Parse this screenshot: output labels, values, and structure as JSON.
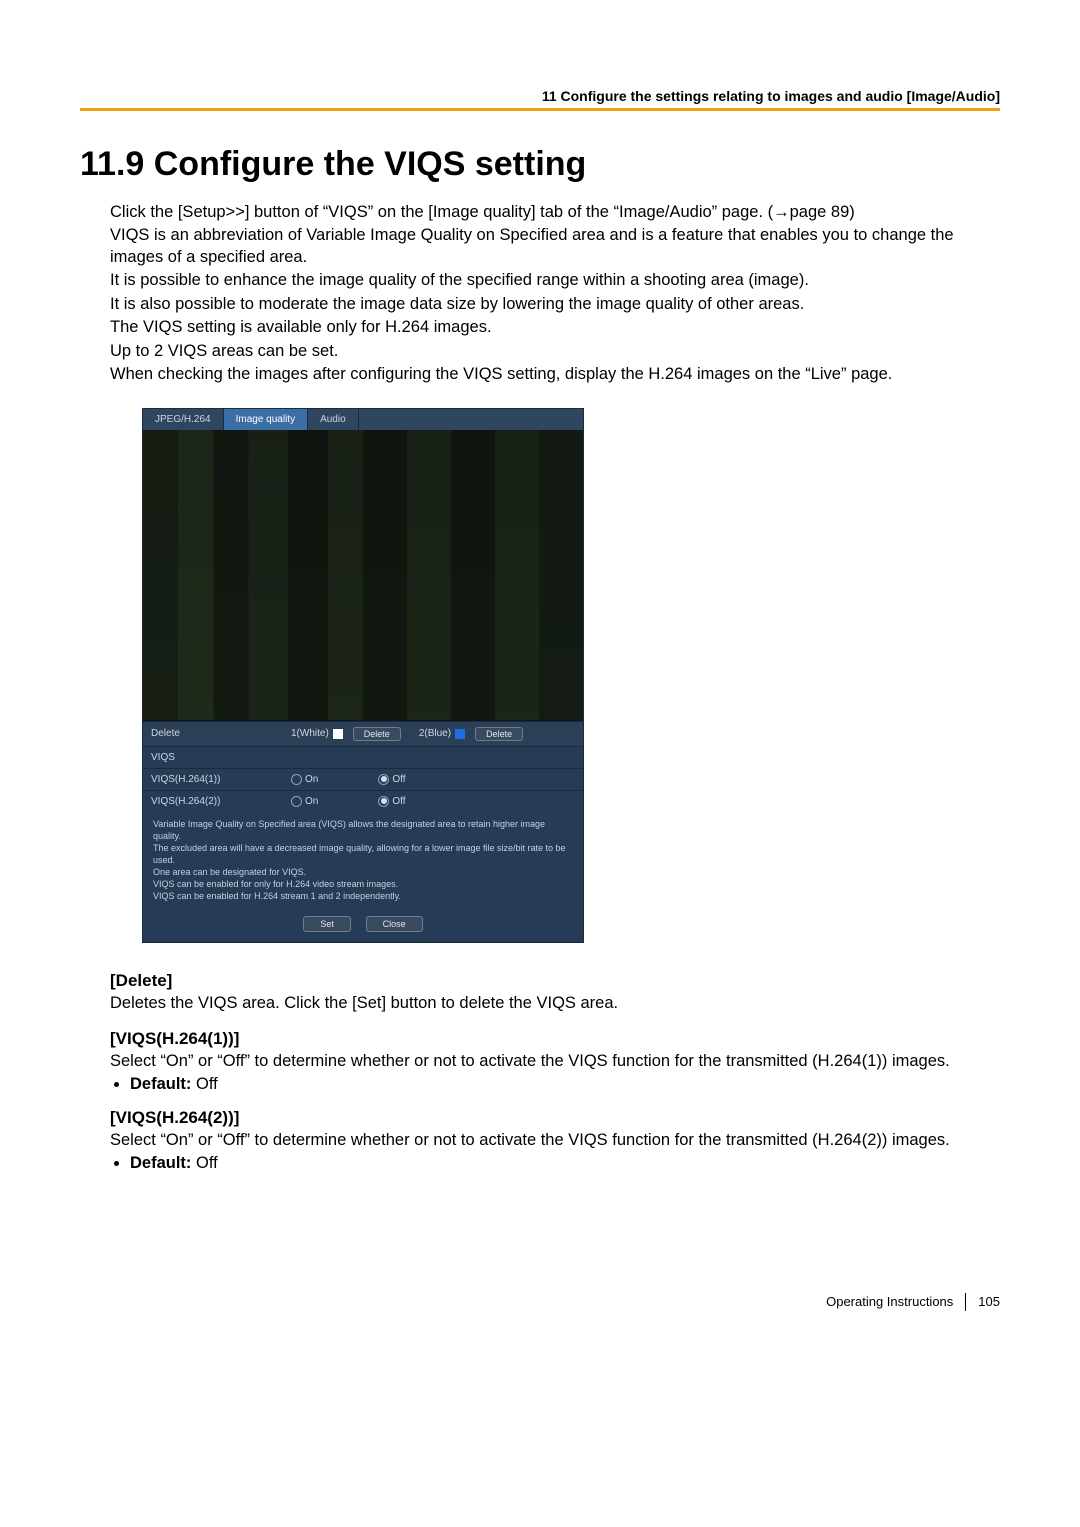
{
  "header": {
    "running_head": "11 Configure the settings relating to images and audio [Image/Audio]"
  },
  "section": {
    "title": "11.9   Configure the VIQS setting"
  },
  "intro": {
    "p1": "Click the [Setup>>] button of “VIQS” on the [Image quality] tab of the “Image/Audio” page. (→page 89)",
    "p2": "VIQS is an abbreviation of Variable Image Quality on Specified area and is a feature that enables you to change the images of a specified area.",
    "p3": "It is possible to enhance the image quality of the specified range within a shooting area (image).",
    "p4": "It is also possible to moderate the image data size by lowering the image quality of other areas.",
    "p5": "The VIQS setting is available only for H.264 images.",
    "p6": "Up to 2 VIQS areas can be set.",
    "p7": "When checking the images after configuring the VIQS setting, display the H.264 images on the “Live” page."
  },
  "screenshot": {
    "tabs": {
      "jpeg": "JPEG/H.264",
      "iq": "Image quality",
      "audio": "Audio"
    },
    "row_delete": {
      "label": "Delete",
      "area1_label": "1(White)",
      "area1_color": "#ffffff",
      "area2_label": "2(Blue)",
      "area2_color": "#1f6fe0",
      "delete_btn": "Delete"
    },
    "row_viqs": {
      "label": "VIQS"
    },
    "row_h1": {
      "label": "VIQS(H.264(1))",
      "on": "On",
      "off": "Off"
    },
    "row_h2": {
      "label": "VIQS(H.264(2))",
      "on": "On",
      "off": "Off"
    },
    "notes": {
      "l1": "Variable Image Quality on Specified area (VIQS) allows the designated area to retain higher image quality.",
      "l2": "The excluded area will have a decreased image quality, allowing for a lower image file size/bit rate to be used.",
      "l3": "One area can be designated for VIQS.",
      "l4": "VIQS can be enabled for only for H.264 video stream images.",
      "l5": "VIQS can be enabled for H.264 stream 1 and 2 independently."
    },
    "buttons": {
      "set": "Set",
      "close": "Close"
    }
  },
  "definitions": {
    "delete_h": "[Delete]",
    "delete_p": "Deletes the VIQS area. Click the [Set] button to delete the VIQS area.",
    "h1_h": "[VIQS(H.264(1))]",
    "h1_p": "Select “On” or “Off” to determine whether or not to activate the VIQS function for the transmitted (H.264(1)) images.",
    "h2_h": "[VIQS(H.264(2))]",
    "h2_p": "Select “On” or “Off” to determine whether or not to activate the VIQS function for the transmitted (H.264(2)) images.",
    "default_label": "Default:",
    "default_value": " Off"
  },
  "footer": {
    "doc": "Operating Instructions",
    "page": "105"
  }
}
